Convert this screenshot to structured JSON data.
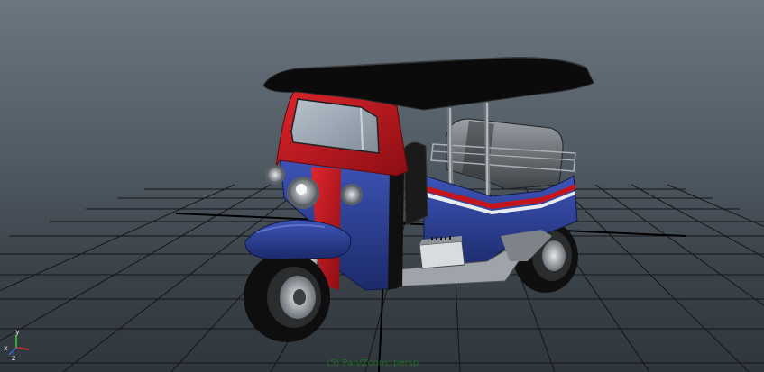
{
  "viewport": {
    "status_text": "(5) Pan/Zoom: persp",
    "axis_labels": {
      "x": "x",
      "y": "y",
      "z": "z"
    }
  },
  "colors": {
    "bg_top": "#6a7680",
    "bg_bottom": "#2f363c",
    "grid": "#141414",
    "body_blue": "#2a3c8f",
    "body_red": "#c4141c",
    "roof": "#0a0a0a",
    "chrome": "#c9ced3",
    "tire": "#111111",
    "status_text": "#1f6a2a"
  },
  "icons": [
    "axis-gizmo-icon"
  ]
}
